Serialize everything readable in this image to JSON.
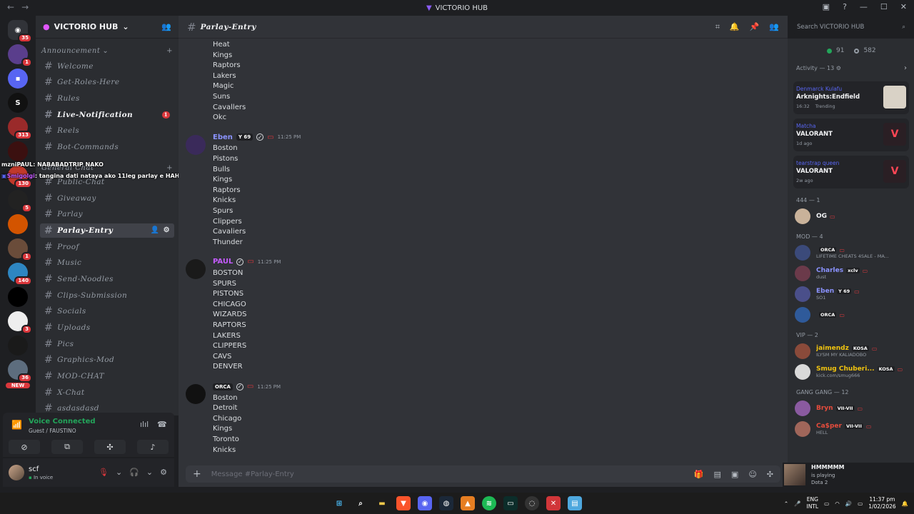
{
  "window": {
    "title": "VICTORIO HUB"
  },
  "server_rail": {
    "servers": [
      {
        "name": "home",
        "badge": "35",
        "color": "#313338",
        "glyph": "◉"
      },
      {
        "name": "server-2",
        "badge": "1",
        "color": "#5a3e8c",
        "glyph": ""
      },
      {
        "name": "folder",
        "badge": "",
        "color": "#5865f2",
        "glyph": "▪"
      },
      {
        "name": "server-4",
        "badge": "",
        "color": "#111",
        "glyph": "S"
      },
      {
        "name": "server-5",
        "badge": "313",
        "color": "#9a2a2a",
        "glyph": ""
      },
      {
        "name": "server-6",
        "badge": "",
        "color": "#3b1010",
        "glyph": ""
      },
      {
        "name": "server-7",
        "badge": "130",
        "color": "#c0392b",
        "glyph": ""
      },
      {
        "name": "server-8",
        "badge": "5",
        "color": "#222",
        "glyph": ""
      },
      {
        "name": "server-9",
        "badge": "",
        "color": "#d35400",
        "glyph": ""
      },
      {
        "name": "server-10",
        "badge": "1",
        "color": "#6a4c3a",
        "glyph": ""
      },
      {
        "name": "server-11",
        "badge": "140",
        "color": "#2e86c1",
        "glyph": ""
      },
      {
        "name": "server-12",
        "badge": "",
        "color": "#000",
        "glyph": ""
      },
      {
        "name": "server-13",
        "badge": "3",
        "color": "#eee",
        "glyph": ""
      },
      {
        "name": "server-14",
        "badge": "",
        "color": "#1a1a1a",
        "glyph": ""
      },
      {
        "name": "server-15",
        "badge": "36",
        "color": "#5d6d7e",
        "glyph": ""
      }
    ],
    "new_label": "NEW"
  },
  "sidebar": {
    "server_name": "VICTORIO HUB",
    "category_announcement": "Announcement",
    "category_general": "General Chat",
    "channels_a": [
      {
        "name": "Welcome",
        "state": ""
      },
      {
        "name": "Get-Roles-Here",
        "state": ""
      },
      {
        "name": "Rules",
        "state": ""
      },
      {
        "name": "Live-Notification",
        "state": "unread",
        "badge": "1"
      },
      {
        "name": "Reels",
        "state": ""
      },
      {
        "name": "Bot-Commands",
        "state": ""
      }
    ],
    "channels_b": [
      {
        "name": "Public-Chat",
        "state": ""
      },
      {
        "name": "Giveaway",
        "state": ""
      },
      {
        "name": "Parlay",
        "state": ""
      },
      {
        "name": "Parlay-Entry",
        "state": "active"
      },
      {
        "name": "Proof",
        "state": ""
      },
      {
        "name": "Music",
        "state": ""
      },
      {
        "name": "Send-Noodles",
        "state": ""
      },
      {
        "name": "Clips-Submission",
        "state": ""
      },
      {
        "name": "Socials",
        "state": ""
      },
      {
        "name": "Uploads",
        "state": ""
      },
      {
        "name": "Pics",
        "state": ""
      },
      {
        "name": "Graphics-Mod",
        "state": ""
      },
      {
        "name": "MOD-CHAT",
        "state": ""
      },
      {
        "name": "X-Chat",
        "state": ""
      },
      {
        "name": "asdasdasd",
        "state": ""
      }
    ]
  },
  "overlay": {
    "line1_name": "mzniPAUL",
    "line1_text": ": NABABADTRIP NAKO",
    "line2_name": "Smigolgi",
    "line2_text": ": tangina dati nataya ako 11leg parlay e HAHAHAHAHAH"
  },
  "voice": {
    "status": "Voice Connected",
    "channel": "Guest / FAUSTINO"
  },
  "user": {
    "name": "scf",
    "status": "In voice"
  },
  "channel": {
    "name": "Parlay-Entry",
    "composer_placeholder": "Message #Parlay-Entry"
  },
  "messages": [
    {
      "lines": [
        "Heat",
        "Kings",
        "Raptors",
        "Lakers",
        "Magic",
        "Suns",
        "Cavallers",
        "Okc"
      ]
    },
    {
      "author": "Eben",
      "tag": "Y 69",
      "time": "11:25 PM",
      "author_color": "#8b93ff",
      "lines": [
        "Boston",
        "Pistons",
        "Bulls",
        "Kings",
        "Raptors",
        "Knicks",
        "Spurs",
        "Clippers",
        "Cavaliers",
        "Thunder"
      ]
    },
    {
      "author": "PAUL",
      "tag": "",
      "time": "11:25 PM",
      "author_color": "#c45bff",
      "lines": [
        "BOSTON",
        "SPURS",
        "PISTONS",
        "CHICAGO",
        "WIZARDS",
        "RAPTORS",
        "LAKERS",
        "CLIPPERS",
        "CAVS",
        "DENVER"
      ]
    },
    {
      "author": "",
      "tag": "ORCA",
      "time": "11:25 PM",
      "author_color": "#f2f3f5",
      "lines": [
        "Boston",
        "Detroit",
        "Chicago",
        "Kings",
        "Toronto",
        "Knicks"
      ]
    }
  ],
  "search": {
    "placeholder": "Search VICTORIO HUB"
  },
  "members": {
    "online": "91",
    "total": "582",
    "activity_header": "Activity — 13",
    "activity": [
      {
        "user": "Denmarck Kulafu",
        "game": "Arknights:Endfield",
        "time": "16:32",
        "extra": "Trending",
        "art": "#d9d2c6"
      },
      {
        "user": "Matcha",
        "game": "VALORANT",
        "time": "1d ago",
        "extra": "",
        "art": "#2a1f24"
      },
      {
        "user": "tearstrap queen",
        "game": "VALORANT",
        "time": "2w ago",
        "extra": "",
        "art": "#2a1f24"
      }
    ],
    "groups": [
      {
        "title": "444 — 1",
        "members": [
          {
            "name": "OG",
            "tag": "",
            "sub": "",
            "color": "#f2f3f5",
            "av": "#c9b29a"
          }
        ]
      },
      {
        "title": "MOD — 4",
        "members": [
          {
            "name": "",
            "tag": "ORCA",
            "sub": "LIFETIME CHEATS 4SALE - MA...",
            "color": "#f2f3f5",
            "av": "#3b4a7a"
          },
          {
            "name": "Charles",
            "tag": "xclv",
            "sub": "dust",
            "color": "#8b93ff",
            "av": "#6b3a4a"
          },
          {
            "name": "Eben",
            "tag": "Y 69",
            "sub": "SO1",
            "color": "#8b93ff",
            "av": "#4a4f8a"
          },
          {
            "name": "",
            "tag": "ORCA",
            "sub": "",
            "color": "#f2f3f5",
            "av": "#2f5a9a"
          }
        ]
      },
      {
        "title": "VIP — 2",
        "members": [
          {
            "name": "jaimendz",
            "tag": "KOSA",
            "sub": "ILYSM MY KALIADOBO",
            "color": "#f1c40f",
            "av": "#8a4a3a"
          },
          {
            "name": "Smug Chuberi...",
            "tag": "KOSA",
            "sub": "kick.com/smug666",
            "color": "#f1c40f",
            "av": "#d9d9d9"
          }
        ]
      },
      {
        "title": "GANG GANG — 12",
        "members": [
          {
            "name": "Bryn",
            "tag": "VII-VII",
            "sub": "",
            "color": "#e74c3c",
            "av": "#8a5aa0"
          },
          {
            "name": "Ca$per",
            "tag": "VII-VII",
            "sub": "HELL",
            "color": "#e74c3c",
            "av": "#a0665a"
          }
        ]
      }
    ]
  },
  "now_playing": {
    "title": "HMMMMM",
    "status": "is playing",
    "game": "Dota 2"
  },
  "taskbar": {
    "lang_1": "ENG",
    "lang_2": "INTL",
    "time": "11:37 pm",
    "date": "1/02/2026"
  }
}
